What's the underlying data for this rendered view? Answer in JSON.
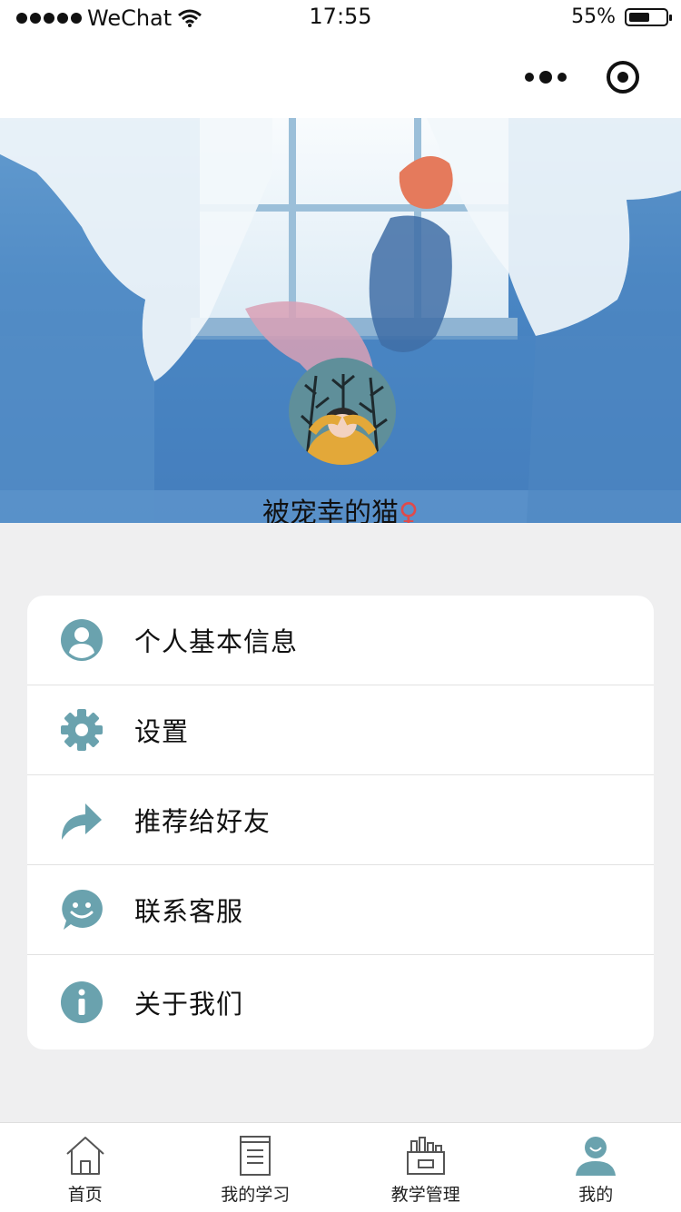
{
  "status_bar": {
    "carrier": "WeChat",
    "time": "17:55",
    "battery": "55%",
    "battery_level": 0.55
  },
  "profile": {
    "username": "被宠幸的猫",
    "gender_symbol": "♀"
  },
  "menu": {
    "items": [
      {
        "label": "个人基本信息",
        "icon": "user-circle-icon"
      },
      {
        "label": "设置",
        "icon": "gear-icon"
      },
      {
        "label": "推荐给好友",
        "icon": "share-arrow-icon"
      },
      {
        "label": "联系客服",
        "icon": "chat-smile-icon"
      },
      {
        "label": "关于我们",
        "icon": "info-icon"
      }
    ]
  },
  "tabbar": {
    "tabs": [
      {
        "label": "首页",
        "icon": "home-icon"
      },
      {
        "label": "我的学习",
        "icon": "notebook-icon"
      },
      {
        "label": "教学管理",
        "icon": "management-icon"
      },
      {
        "label": "我的",
        "icon": "user-icon"
      }
    ],
    "active_index": 3
  },
  "colors": {
    "accent": "#6aa2ae",
    "background": "#efeff0",
    "gender": "#e04a4a"
  }
}
